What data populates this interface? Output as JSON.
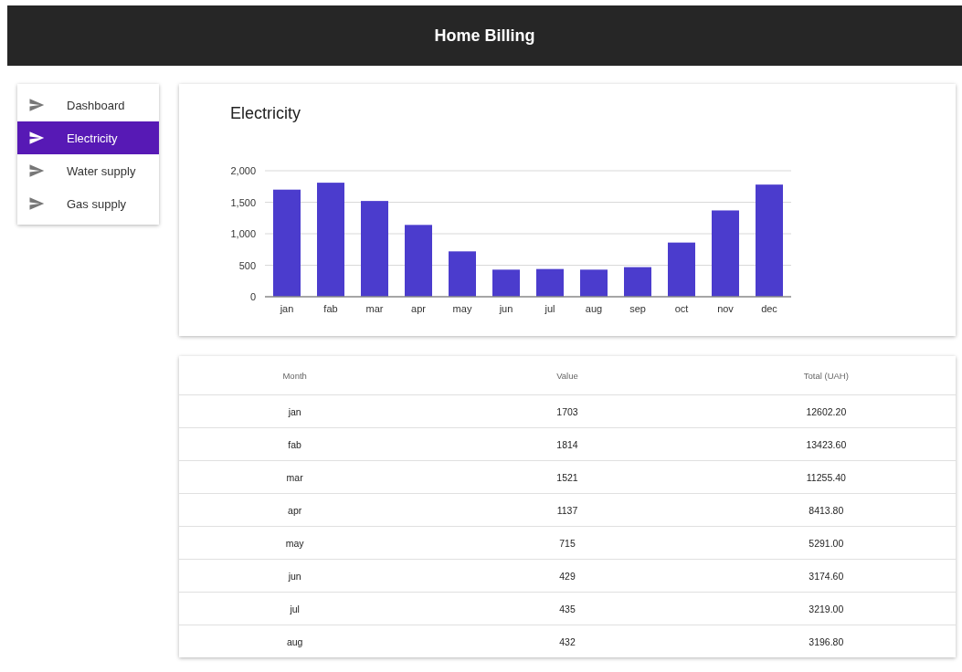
{
  "header": {
    "title": "Home Billing"
  },
  "sidebar": {
    "items": [
      {
        "label": "Dashboard",
        "selected": false
      },
      {
        "label": "Electricity",
        "selected": true
      },
      {
        "label": "Water supply",
        "selected": false
      },
      {
        "label": "Gas supply",
        "selected": false
      }
    ]
  },
  "chart_card": {
    "title": "Electricity",
    "chart_data": {
      "type": "bar",
      "categories": [
        "jan",
        "fab",
        "mar",
        "apr",
        "may",
        "jun",
        "jul",
        "aug",
        "sep",
        "oct",
        "nov",
        "dec"
      ],
      "series": [
        {
          "color": "#4b3ccd",
          "values": [
            1700,
            1810,
            1520,
            1140,
            720,
            430,
            440,
            430,
            470,
            860,
            1370,
            1780
          ]
        }
      ],
      "grid": true,
      "ylim": [
        0,
        2000
      ],
      "yticks": [
        {
          "value": 0,
          "label": "0"
        },
        {
          "value": 500,
          "label": "500"
        },
        {
          "value": 1000,
          "label": "1,000"
        },
        {
          "value": 1500,
          "label": "1,500"
        },
        {
          "value": 2000,
          "label": "2,000"
        }
      ]
    }
  },
  "table": {
    "columns": [
      "Month",
      "Value",
      "Total (UAH)"
    ],
    "rows": [
      [
        "jan",
        "1703",
        "12602.20"
      ],
      [
        "fab",
        "1814",
        "13423.60"
      ],
      [
        "mar",
        "1521",
        "11255.40"
      ],
      [
        "apr",
        "1137",
        "8413.80"
      ],
      [
        "may",
        "715",
        "5291.00"
      ],
      [
        "jun",
        "429",
        "3174.60"
      ],
      [
        "jul",
        "435",
        "3219.00"
      ],
      [
        "aug",
        "432",
        "3196.80"
      ]
    ]
  }
}
